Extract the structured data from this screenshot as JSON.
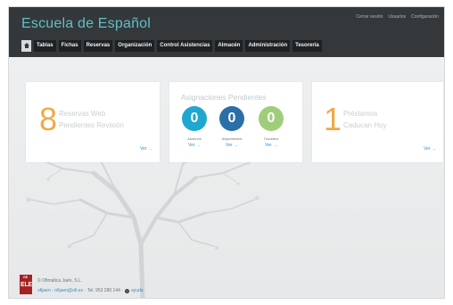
{
  "app": {
    "title": "Escuela de Español"
  },
  "top_links": [
    {
      "label": "Cerrar sesión"
    },
    {
      "label": "Usuarios"
    },
    {
      "label": "Configuración"
    }
  ],
  "nav": {
    "items": [
      {
        "label": "Tablas"
      },
      {
        "label": "Fichas"
      },
      {
        "label": "Reservas"
      },
      {
        "label": "Organización"
      },
      {
        "label": "Control Asistencias"
      },
      {
        "label": "Almacén"
      },
      {
        "label": "Administración"
      },
      {
        "label": "Tesorería"
      }
    ]
  },
  "cards": {
    "reservas": {
      "count": "8",
      "label_line1": "Reservas Web",
      "label_line2": "Pendientes Revisión",
      "link": "Ver →"
    },
    "asignaciones": {
      "title": "Asignaciones Pendientes",
      "items": [
        {
          "count": "0",
          "label": "Alumnos",
          "link": "Ver →"
        },
        {
          "count": "0",
          "label": "Alojamientos",
          "link": "Ver →"
        },
        {
          "count": "0",
          "label": "Transfers",
          "link": "Ver →"
        }
      ]
    },
    "prestamos": {
      "count": "1",
      "label_line1": "Préstamos",
      "label_line2": "Caducan Hoy",
      "link": "Ver →"
    }
  },
  "footer": {
    "logo_text": "ELE",
    "logo_mini": "GE",
    "company": "© Ofimática Jaén, S.L.",
    "email": "ofijaen - ofijaen@ofi.es",
    "phone": "· Tel. 953 280 144 ·",
    "help": "ayuda"
  },
  "colors": {
    "header_bg": "#34383b",
    "title": "#5fc0c6",
    "accent_orange": "#f0aa45",
    "circle_cyan": "#1fa7cf",
    "circle_blue": "#2b6fa8",
    "circle_green": "#9fce7a",
    "link": "#3a91c7"
  }
}
